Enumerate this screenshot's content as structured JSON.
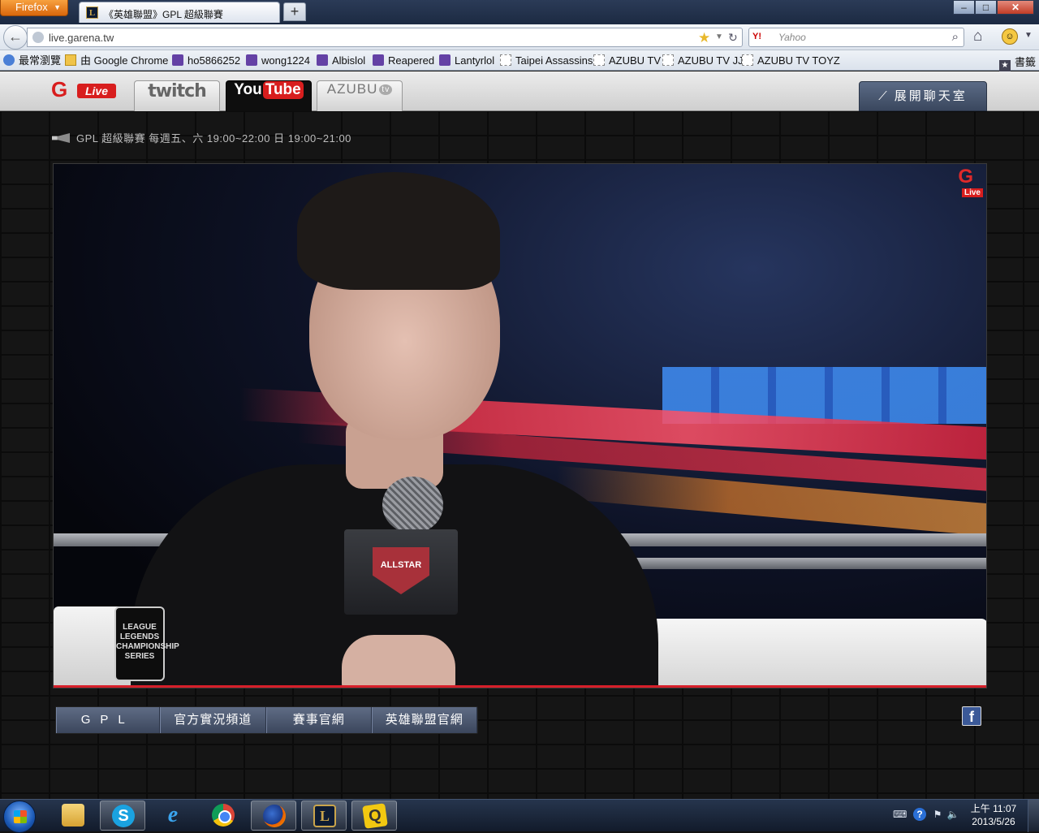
{
  "browser": {
    "menu_button": "Firefox",
    "tab": {
      "title": "《英雄聯盟》GPL 超級聯賽",
      "favicon_letter": "L"
    },
    "new_tab": "+",
    "window": {
      "minimize": "–",
      "maximize": "□",
      "close": "✕"
    },
    "url": "live.garena.tw",
    "search": {
      "engine": "Y!",
      "placeholder": "Yahoo"
    },
    "bookmarks": [
      {
        "label": "最常瀏覽",
        "icon": "folder-icon"
      },
      {
        "label": "由 Google Chrome",
        "icon": "folder-icon"
      },
      {
        "label": "ho5866252",
        "icon": "twitch-icon"
      },
      {
        "label": "wong1224",
        "icon": "twitch-icon"
      },
      {
        "label": "Albislol",
        "icon": "twitch-icon"
      },
      {
        "label": "Reapered",
        "icon": "twitch-icon"
      },
      {
        "label": "Lantyrlol",
        "icon": "twitch-icon"
      },
      {
        "label": "Taipei Assassins",
        "icon": "blank-page-icon"
      },
      {
        "label": "AZUBU TV",
        "icon": "blank-page-icon"
      },
      {
        "label": "AZUBU TV JJ",
        "icon": "blank-page-icon"
      },
      {
        "label": "AZUBU TV TOYZ",
        "icon": "blank-page-icon"
      }
    ],
    "bookmarks_menu": "書籤"
  },
  "site": {
    "logo": {
      "g": "G",
      "live": "Live"
    },
    "tabs": [
      {
        "label": "twitch",
        "active": false
      },
      {
        "label_you": "You",
        "label_tube": "Tube",
        "active": true
      },
      {
        "label": "AZUBU",
        "active": false
      }
    ],
    "chat_button": "展開聊天室",
    "announcement": "GPL 超級聯賽 每週五、六 19:00~22:00 日 19:00~21:00",
    "video": {
      "watermark_g": "G",
      "watermark_live": "Live",
      "mic_flag_text": "ALLSTAR",
      "patch_text": "LEAGUE LEGENDS CHAMPIONSHIP SERIES",
      "progress": 1.0
    },
    "footer_nav": [
      "GPL",
      "官方實況頻道",
      "賽事官網",
      "英雄聯盟官網"
    ],
    "facebook_icon": "f"
  },
  "taskbar": {
    "apps": [
      "explorer",
      "skype",
      "internet-explorer",
      "chrome",
      "firefox",
      "league-of-legends",
      "app"
    ],
    "skype_letter": "S",
    "ie_letter": "e",
    "lol_letter": "L",
    "app_letter": "Q",
    "clock_time": "上午 11:07",
    "clock_date": "2013/5/26"
  },
  "colors": {
    "accent_red": "#d81e1e",
    "chat_button": "#4a5770",
    "footer_nav": "#4d5a73"
  }
}
